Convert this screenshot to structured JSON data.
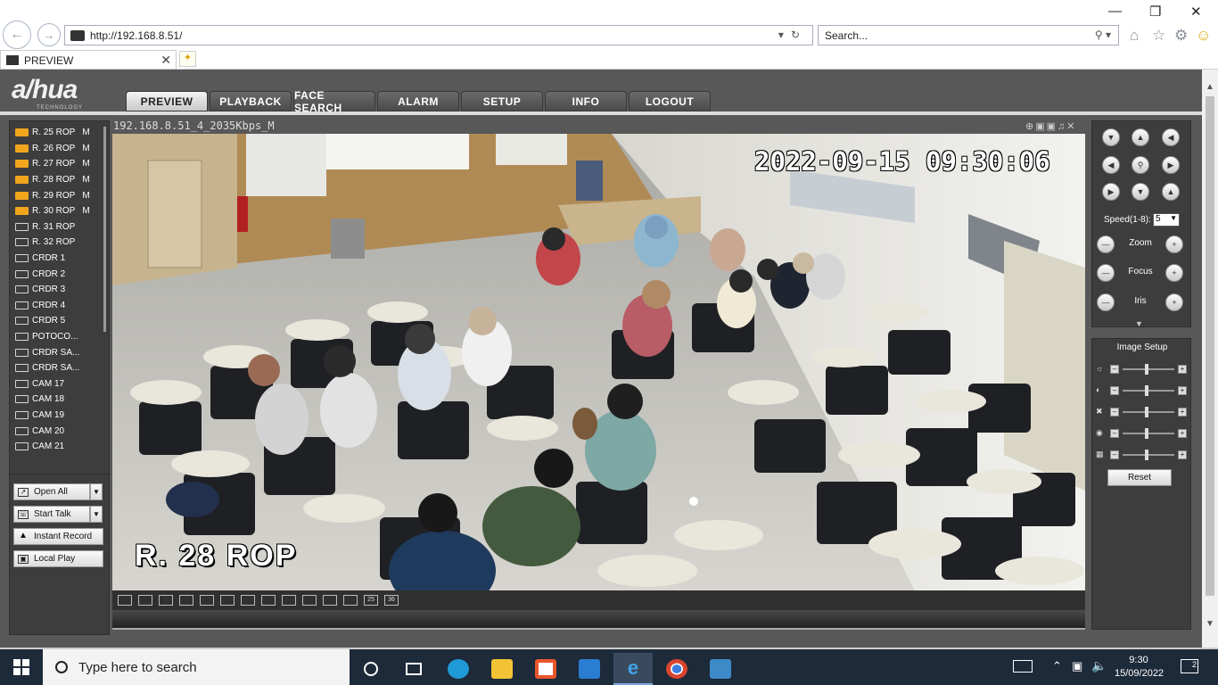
{
  "browser": {
    "url": "http://192.168.8.51/",
    "search_placeholder": "Search...",
    "tab_title": "PREVIEW"
  },
  "app": {
    "logo": "a/hua",
    "logo_sub": "TECHNOLOGY",
    "menu": [
      "PREVIEW",
      "PLAYBACK",
      "FACE SEARCH",
      "ALARM",
      "SETUP",
      "INFO",
      "LOGOUT"
    ],
    "active_menu": "PREVIEW"
  },
  "channels": [
    {
      "name": "R. 25 ROP",
      "mode": "M",
      "active": true
    },
    {
      "name": "R. 26 ROP",
      "mode": "M",
      "active": true
    },
    {
      "name": "R. 27 ROP",
      "mode": "M",
      "active": true
    },
    {
      "name": "R. 28 ROP",
      "mode": "M",
      "active": true
    },
    {
      "name": "R. 29 ROP",
      "mode": "M",
      "active": true
    },
    {
      "name": "R. 30 ROP",
      "mode": "M",
      "active": true
    },
    {
      "name": "R. 31 ROP",
      "mode": "",
      "active": false
    },
    {
      "name": "R. 32 ROP",
      "mode": "",
      "active": false
    },
    {
      "name": "CRDR 1",
      "mode": "",
      "active": false
    },
    {
      "name": "CRDR 2",
      "mode": "",
      "active": false
    },
    {
      "name": "CRDR 3",
      "mode": "",
      "active": false
    },
    {
      "name": "CRDR 4",
      "mode": "",
      "active": false
    },
    {
      "name": "CRDR 5",
      "mode": "",
      "active": false
    },
    {
      "name": "POTOCO...",
      "mode": "",
      "active": false
    },
    {
      "name": "CRDR SA...",
      "mode": "",
      "active": false
    },
    {
      "name": "CRDR SA...",
      "mode": "",
      "active": false
    },
    {
      "name": "CAM 17",
      "mode": "",
      "active": false
    },
    {
      "name": "CAM 18",
      "mode": "",
      "active": false
    },
    {
      "name": "CAM 19",
      "mode": "",
      "active": false
    },
    {
      "name": "CAM 20",
      "mode": "",
      "active": false
    },
    {
      "name": "CAM 21",
      "mode": "",
      "active": false
    }
  ],
  "controls": {
    "open_all": "Open All",
    "start_talk": "Start Talk",
    "instant_record": "Instant Record",
    "local_play": "Local Play"
  },
  "video": {
    "label": "192.168.8.51_4_2035Kbps_M",
    "osd_time": "2022-09-15 09:30:06",
    "osd_name": "R. 28 ROP"
  },
  "layouts": [
    "",
    "",
    "",
    "",
    "",
    "",
    "",
    "",
    "",
    "",
    "",
    "",
    "25",
    "36"
  ],
  "ptz": {
    "speed_label": "Speed(1-8):",
    "speed_value": "5",
    "zoom": "Zoom",
    "focus": "Focus",
    "iris": "Iris"
  },
  "image_setup": {
    "title": "Image Setup",
    "reset": "Reset"
  },
  "taskbar": {
    "search_placeholder": "Type here to search",
    "time": "9:30",
    "date": "15/09/2022",
    "notifications": "2"
  }
}
